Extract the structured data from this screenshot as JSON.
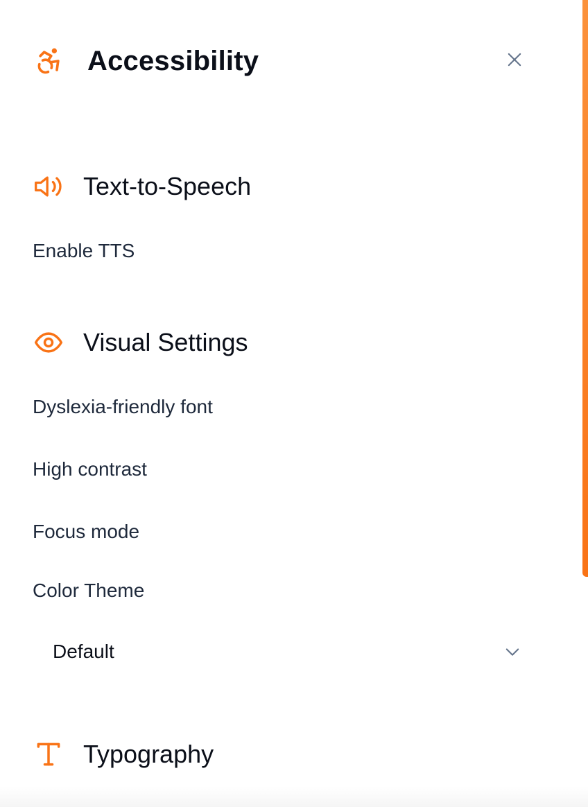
{
  "header": {
    "title": "Accessibility",
    "close_icon": "close-icon",
    "logo_icon": "accessibility-icon"
  },
  "colors": {
    "accent": "#f97316",
    "accent_light": "#fb923c",
    "text_primary": "#0b0f19",
    "text_secondary": "#1e293b",
    "muted_icon": "#64748b"
  },
  "sections": {
    "tts": {
      "title": "Text-to-Speech",
      "icon": "speaker-icon",
      "options": {
        "enable_tts": "Enable TTS"
      }
    },
    "visual": {
      "title": "Visual Settings",
      "icon": "eye-icon",
      "options": {
        "dyslexia_font": "Dyslexia-friendly font",
        "high_contrast": "High contrast",
        "focus_mode": "Focus mode",
        "color_theme": "Color Theme"
      },
      "color_theme_select": {
        "value": "Default",
        "icon": "chevron-down-icon"
      }
    },
    "typography": {
      "title": "Typography",
      "icon": "type-icon"
    }
  }
}
